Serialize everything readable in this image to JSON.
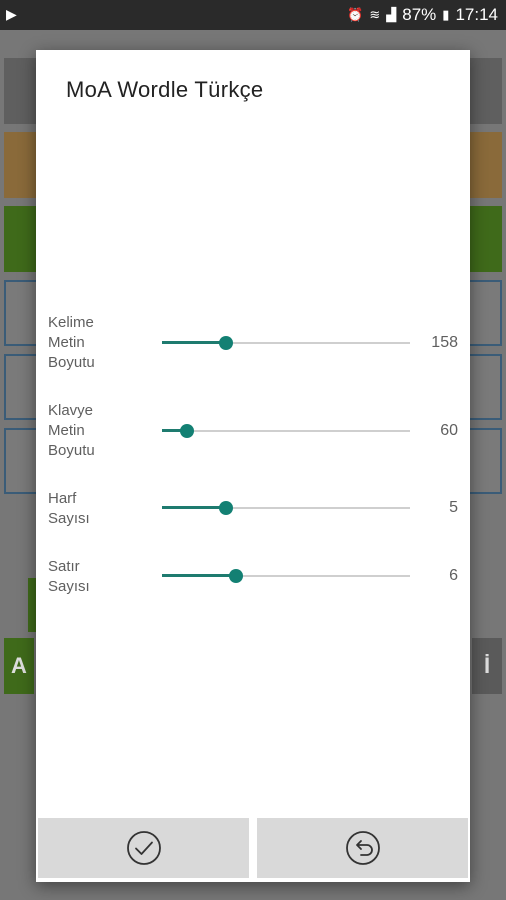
{
  "status_bar": {
    "battery": "87%",
    "time": "17:14"
  },
  "dialog": {
    "title": "MoA Wordle Türkçe",
    "settings": [
      {
        "label": "Kelime\nMetin\nBoyutu",
        "value": "158",
        "fraction": 0.26
      },
      {
        "label": "Klavye\nMetin\nBoyutu",
        "value": "60",
        "fraction": 0.1
      },
      {
        "label": "Harf\nSayısı",
        "value": "5",
        "fraction": 0.26
      },
      {
        "label": "Satır\nSayısı",
        "value": "6",
        "fraction": 0.3
      }
    ],
    "buttons": {
      "confirm_icon": "checkmark-circle-icon",
      "back_icon": "undo-circle-icon"
    }
  },
  "background": {
    "key_left": "A",
    "key_right": "İ"
  },
  "colors": {
    "accent": "#138073",
    "dialog_bg": "#ffffff",
    "button_bg": "#d9d9d9"
  }
}
